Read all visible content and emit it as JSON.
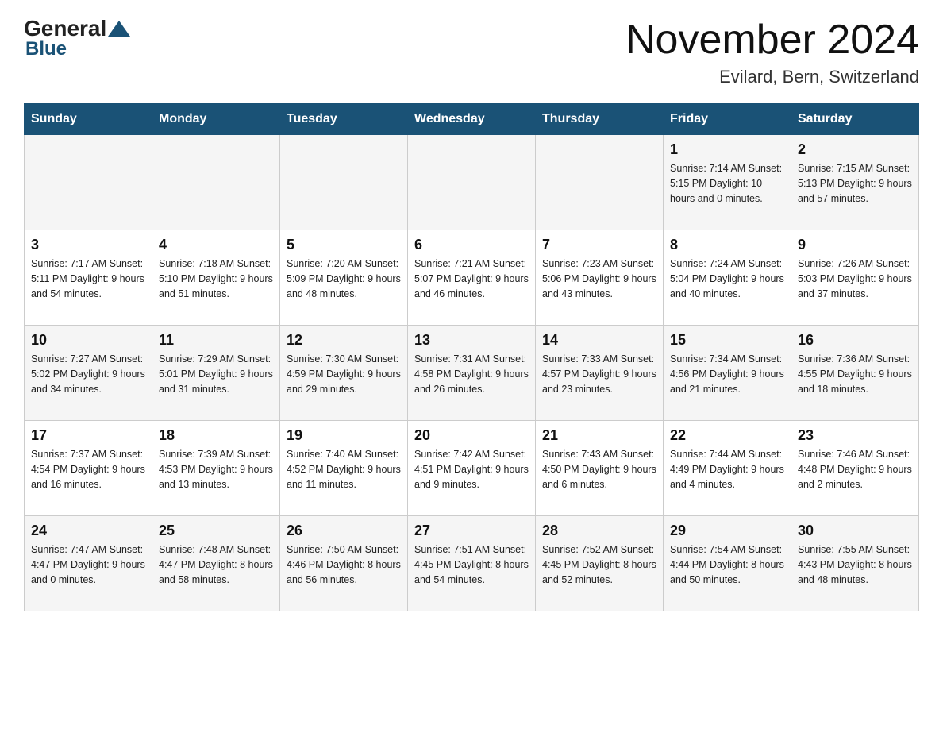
{
  "header": {
    "logo_general": "General",
    "logo_blue": "Blue",
    "month_title": "November 2024",
    "location": "Evilard, Bern, Switzerland"
  },
  "days_of_week": [
    "Sunday",
    "Monday",
    "Tuesday",
    "Wednesday",
    "Thursday",
    "Friday",
    "Saturday"
  ],
  "weeks": [
    [
      {
        "day": "",
        "info": ""
      },
      {
        "day": "",
        "info": ""
      },
      {
        "day": "",
        "info": ""
      },
      {
        "day": "",
        "info": ""
      },
      {
        "day": "",
        "info": ""
      },
      {
        "day": "1",
        "info": "Sunrise: 7:14 AM\nSunset: 5:15 PM\nDaylight: 10 hours and 0 minutes."
      },
      {
        "day": "2",
        "info": "Sunrise: 7:15 AM\nSunset: 5:13 PM\nDaylight: 9 hours and 57 minutes."
      }
    ],
    [
      {
        "day": "3",
        "info": "Sunrise: 7:17 AM\nSunset: 5:11 PM\nDaylight: 9 hours and 54 minutes."
      },
      {
        "day": "4",
        "info": "Sunrise: 7:18 AM\nSunset: 5:10 PM\nDaylight: 9 hours and 51 minutes."
      },
      {
        "day": "5",
        "info": "Sunrise: 7:20 AM\nSunset: 5:09 PM\nDaylight: 9 hours and 48 minutes."
      },
      {
        "day": "6",
        "info": "Sunrise: 7:21 AM\nSunset: 5:07 PM\nDaylight: 9 hours and 46 minutes."
      },
      {
        "day": "7",
        "info": "Sunrise: 7:23 AM\nSunset: 5:06 PM\nDaylight: 9 hours and 43 minutes."
      },
      {
        "day": "8",
        "info": "Sunrise: 7:24 AM\nSunset: 5:04 PM\nDaylight: 9 hours and 40 minutes."
      },
      {
        "day": "9",
        "info": "Sunrise: 7:26 AM\nSunset: 5:03 PM\nDaylight: 9 hours and 37 minutes."
      }
    ],
    [
      {
        "day": "10",
        "info": "Sunrise: 7:27 AM\nSunset: 5:02 PM\nDaylight: 9 hours and 34 minutes."
      },
      {
        "day": "11",
        "info": "Sunrise: 7:29 AM\nSunset: 5:01 PM\nDaylight: 9 hours and 31 minutes."
      },
      {
        "day": "12",
        "info": "Sunrise: 7:30 AM\nSunset: 4:59 PM\nDaylight: 9 hours and 29 minutes."
      },
      {
        "day": "13",
        "info": "Sunrise: 7:31 AM\nSunset: 4:58 PM\nDaylight: 9 hours and 26 minutes."
      },
      {
        "day": "14",
        "info": "Sunrise: 7:33 AM\nSunset: 4:57 PM\nDaylight: 9 hours and 23 minutes."
      },
      {
        "day": "15",
        "info": "Sunrise: 7:34 AM\nSunset: 4:56 PM\nDaylight: 9 hours and 21 minutes."
      },
      {
        "day": "16",
        "info": "Sunrise: 7:36 AM\nSunset: 4:55 PM\nDaylight: 9 hours and 18 minutes."
      }
    ],
    [
      {
        "day": "17",
        "info": "Sunrise: 7:37 AM\nSunset: 4:54 PM\nDaylight: 9 hours and 16 minutes."
      },
      {
        "day": "18",
        "info": "Sunrise: 7:39 AM\nSunset: 4:53 PM\nDaylight: 9 hours and 13 minutes."
      },
      {
        "day": "19",
        "info": "Sunrise: 7:40 AM\nSunset: 4:52 PM\nDaylight: 9 hours and 11 minutes."
      },
      {
        "day": "20",
        "info": "Sunrise: 7:42 AM\nSunset: 4:51 PM\nDaylight: 9 hours and 9 minutes."
      },
      {
        "day": "21",
        "info": "Sunrise: 7:43 AM\nSunset: 4:50 PM\nDaylight: 9 hours and 6 minutes."
      },
      {
        "day": "22",
        "info": "Sunrise: 7:44 AM\nSunset: 4:49 PM\nDaylight: 9 hours and 4 minutes."
      },
      {
        "day": "23",
        "info": "Sunrise: 7:46 AM\nSunset: 4:48 PM\nDaylight: 9 hours and 2 minutes."
      }
    ],
    [
      {
        "day": "24",
        "info": "Sunrise: 7:47 AM\nSunset: 4:47 PM\nDaylight: 9 hours and 0 minutes."
      },
      {
        "day": "25",
        "info": "Sunrise: 7:48 AM\nSunset: 4:47 PM\nDaylight: 8 hours and 58 minutes."
      },
      {
        "day": "26",
        "info": "Sunrise: 7:50 AM\nSunset: 4:46 PM\nDaylight: 8 hours and 56 minutes."
      },
      {
        "day": "27",
        "info": "Sunrise: 7:51 AM\nSunset: 4:45 PM\nDaylight: 8 hours and 54 minutes."
      },
      {
        "day": "28",
        "info": "Sunrise: 7:52 AM\nSunset: 4:45 PM\nDaylight: 8 hours and 52 minutes."
      },
      {
        "day": "29",
        "info": "Sunrise: 7:54 AM\nSunset: 4:44 PM\nDaylight: 8 hours and 50 minutes."
      },
      {
        "day": "30",
        "info": "Sunrise: 7:55 AM\nSunset: 4:43 PM\nDaylight: 8 hours and 48 minutes."
      }
    ]
  ]
}
